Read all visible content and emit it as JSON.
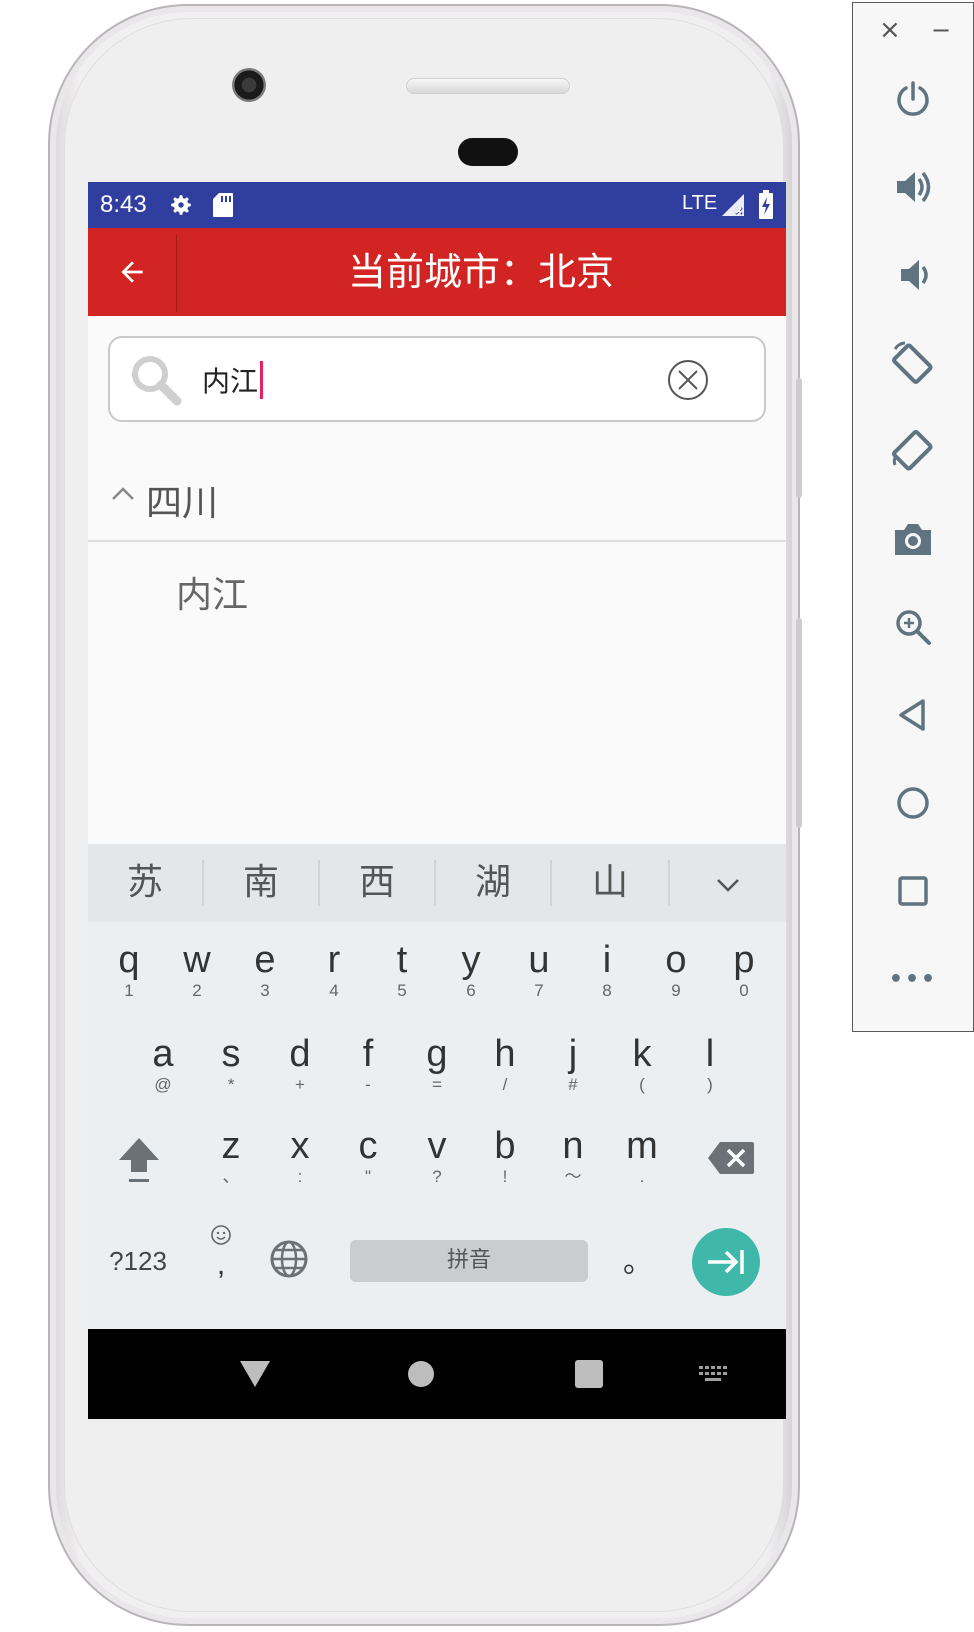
{
  "status_bar": {
    "time": "8:43",
    "network": "LTE",
    "bg_color": "#303f9f",
    "icons": [
      "settings-icon",
      "sd-card-icon",
      "signal-icon",
      "battery-charging-icon"
    ]
  },
  "toolbar": {
    "title": "当前城市：北京",
    "bg_color": "#d32424",
    "back_icon": "arrow-left-icon"
  },
  "search": {
    "value": "内江",
    "icons": [
      "search-icon",
      "clear-icon"
    ]
  },
  "results": {
    "group_label": "四川",
    "items": [
      "内江"
    ]
  },
  "keyboard": {
    "candidates": [
      "苏",
      "南",
      "西",
      "湖",
      "山"
    ],
    "row1": [
      [
        "q",
        "1"
      ],
      [
        "w",
        "2"
      ],
      [
        "e",
        "3"
      ],
      [
        "r",
        "4"
      ],
      [
        "t",
        "5"
      ],
      [
        "y",
        "6"
      ],
      [
        "u",
        "7"
      ],
      [
        "i",
        "8"
      ],
      [
        "o",
        "9"
      ],
      [
        "p",
        "0"
      ]
    ],
    "row2": [
      [
        "a",
        "@"
      ],
      [
        "s",
        "*"
      ],
      [
        "d",
        "+"
      ],
      [
        "f",
        "-"
      ],
      [
        "g",
        "="
      ],
      [
        "h",
        "/"
      ],
      [
        "j",
        "#"
      ],
      [
        "k",
        "("
      ],
      [
        "l",
        ")"
      ]
    ],
    "row3": [
      [
        "z",
        "、"
      ],
      [
        "x",
        ":"
      ],
      [
        "c",
        "\""
      ],
      [
        "v",
        "?"
      ],
      [
        "b",
        "!"
      ],
      [
        "n",
        "～"
      ],
      [
        "m",
        "."
      ]
    ],
    "symbols_label": "?123",
    "comma": ",",
    "space_label": "拼音",
    "period": "。",
    "enter_color": "#3fb8a9"
  },
  "emulator_panel": {
    "close": "×",
    "minimize": "−",
    "more": "•••",
    "buttons": [
      "power-icon",
      "volume-up-icon",
      "volume-down-icon",
      "rotate-left-icon",
      "rotate-right-icon",
      "camera-icon",
      "zoom-icon",
      "back-icon",
      "home-icon",
      "overview-icon",
      "more-icon"
    ]
  }
}
